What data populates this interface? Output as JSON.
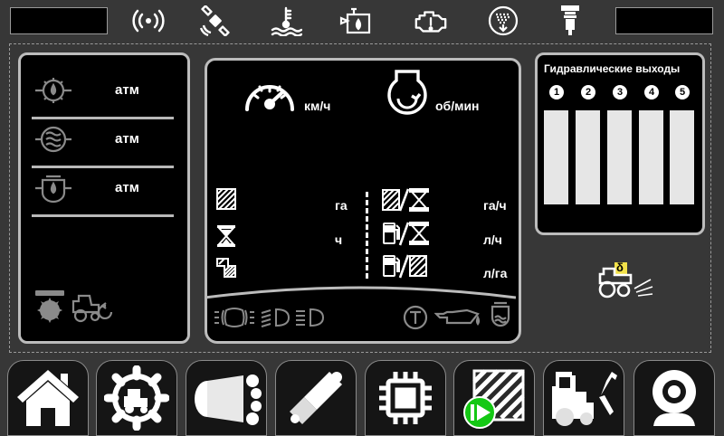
{
  "top_bar": {
    "icons": [
      "radio-signal-icon",
      "satellite-icon",
      "coolant-temperature-icon",
      "fuel-tank-icon",
      "engine-warning-icon",
      "filter-icon",
      "sensor-icon"
    ]
  },
  "pressures": {
    "row1_unit": "атм",
    "row2_unit": "атм",
    "row3_unit": "атм"
  },
  "center": {
    "speed_unit": "км/ч",
    "rpm_unit": "об/мин",
    "left_units": [
      "га",
      "ч"
    ],
    "right_units": [
      "га/ч",
      "л/ч",
      "л/га"
    ]
  },
  "hydraulics": {
    "title": "Гидравлические выходы",
    "outputs": [
      "1",
      "2",
      "3",
      "4",
      "5"
    ]
  },
  "status_badge": {
    "delta": "δ"
  },
  "bottom_nav": [
    "home-button",
    "tractor-settings-button",
    "spray-button",
    "hydraulic-cylinder-button",
    "processor-button",
    "field-start-button",
    "tractor-service-button",
    "camera-button"
  ]
}
